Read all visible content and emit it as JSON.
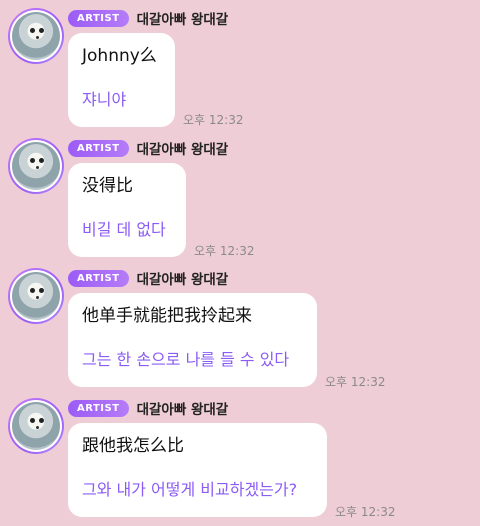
{
  "messages": [
    {
      "badge": "ARTIST",
      "sender": "대갈아빠 왕대갈",
      "original": "Johnny么",
      "translation": "쟈니야",
      "time": "오후 12:32"
    },
    {
      "badge": "ARTIST",
      "sender": "대갈아빠 왕대갈",
      "original": "没得比",
      "translation": "비길 데 없다",
      "time": "오후 12:32"
    },
    {
      "badge": "ARTIST",
      "sender": "대갈아빠 왕대갈",
      "original": "他单手就能把我拎起来",
      "translation": "그는 한 손으로 나를 들 수 있다",
      "time": "오후 12:32"
    },
    {
      "badge": "ARTIST",
      "sender": "대갈아빠 왕대갈",
      "original": "跟他我怎么比",
      "translation": "그와 내가 어떻게 비교하겠는가?",
      "time": "오후 12:32"
    }
  ]
}
